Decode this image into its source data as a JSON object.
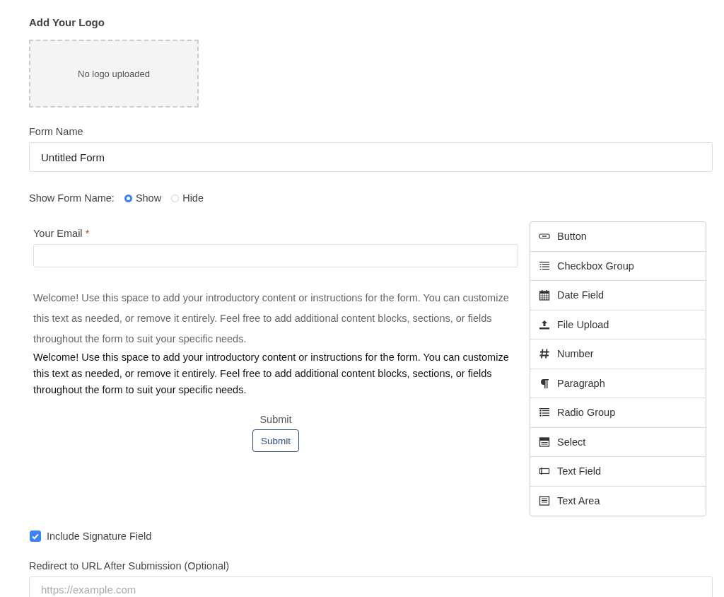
{
  "logo": {
    "heading": "Add Your Logo",
    "empty_text": "No logo uploaded"
  },
  "form_name": {
    "label": "Form Name",
    "value": "Untitled Form"
  },
  "show_form_name": {
    "label": "Show Form Name:",
    "options": [
      {
        "label": "Show",
        "selected": true
      },
      {
        "label": "Hide",
        "selected": false
      }
    ]
  },
  "preview": {
    "email_label": "Your Email",
    "required_mark": "*",
    "intro_gray": "Welcome! Use this space to add your introductory content or instructions for the form. You can customize this text as needed, or remove it entirely. Feel free to add additional content blocks, sections, or fields throughout the form to suit your specific needs.",
    "intro_black": "Welcome! Use this space to add your introductory content or instructions for the form. You can customize this text as needed, or remove it entirely. Feel free to add additional content blocks, sections, or fields throughout the form to suit your specific needs.",
    "submit_label": "Submit",
    "submit_button": "Submit"
  },
  "palette": [
    {
      "label": "Button",
      "kind": "button"
    },
    {
      "label": "Checkbox Group",
      "kind": "checkbox-group"
    },
    {
      "label": "Date Field",
      "kind": "date"
    },
    {
      "label": "File Upload",
      "kind": "upload"
    },
    {
      "label": "Number",
      "kind": "number"
    },
    {
      "label": "Paragraph",
      "kind": "paragraph"
    },
    {
      "label": "Radio Group",
      "kind": "radio-group"
    },
    {
      "label": "Select",
      "kind": "select"
    },
    {
      "label": "Text Field",
      "kind": "text-field"
    },
    {
      "label": "Text Area",
      "kind": "text-area"
    }
  ],
  "signature": {
    "label": "Include Signature Field",
    "checked": true
  },
  "redirect": {
    "label": "Redirect to URL After Submission (Optional)",
    "placeholder": "https://example.com"
  }
}
